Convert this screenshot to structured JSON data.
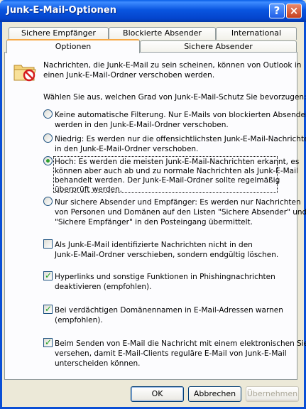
{
  "window": {
    "title": "Junk-E-Mail-Optionen"
  },
  "titlebar_buttons": {
    "help": "?",
    "close": "×"
  },
  "tabs_back": [
    {
      "label": "Sichere Empfänger"
    },
    {
      "label": "Blockierte Absender"
    },
    {
      "label": "International"
    }
  ],
  "tabs_front": [
    {
      "label": "Optionen"
    },
    {
      "label": "Sichere Absender"
    }
  ],
  "intro": {
    "lines": [
      "Nachrichten, die Junk-E-Mail zu sein scheinen, können von Outlook in",
      "einen Junk-E-Mail-Ordner verschoben werden."
    ],
    "icon": "junk-folder-icon"
  },
  "prompt": "Wählen Sie aus, welchen Grad von Junk-E-Mail-Schutz Sie bevorzugen:",
  "radios": [
    {
      "lines": [
        "Keine automatische Filterung. Nur E-Mails von blockierten Absendern",
        "werden in den Junk-E-Mail-Ordner verschoben."
      ],
      "selected": false
    },
    {
      "lines": [
        "Niedrig: Es werden nur die offensichtlichsten Junk-E-Mail-Nachrichten",
        "in den Junk-E-Mail-Ordner verschoben."
      ],
      "selected": false
    },
    {
      "lines": [
        "Hoch: Es werden die meisten Junk-E-Mail-Nachrichten erkannt, es",
        "können aber auch ab und zu normale Nachrichten als Junk-E-Mail",
        "behandelt werden. Der Junk-E-Mail-Ordner sollte regelmäßig",
        "überprüft werden."
      ],
      "selected": true
    },
    {
      "lines": [
        "Nur sichere Absender und Empfänger: Es werden nur Nachrichten",
        "von Personen und Domänen auf den Listen \"Sichere Absender\" und",
        "\"Sichere Empfänger\" in den Posteingang übermittelt."
      ],
      "selected": false
    }
  ],
  "checkboxes": [
    {
      "lines": [
        "Als Junk-E-Mail identifizierte Nachrichten nicht in den",
        "Junk-E-Mail-Ordner verschieben, sondern endgültig löschen."
      ],
      "checked": false
    },
    {
      "lines": [
        "Hyperlinks und sonstige Funktionen in Phishingnachrichten",
        "deaktivieren (empfohlen)."
      ],
      "checked": true
    },
    {
      "lines": [
        "Bei verdächtigen Domänennamen in E-Mail-Adressen warnen",
        "(empfohlen)."
      ],
      "checked": true
    },
    {
      "lines": [
        "Beim Senden von E-Mail die Nachricht mit einem elektronischen Siegel",
        "versehen, damit E-Mail-Clients reguläre E-Mail von Junk-E-Mail",
        "unterscheiden können."
      ],
      "checked": true
    }
  ],
  "buttons": {
    "ok": "OK",
    "cancel": "Abbrechen",
    "apply": "Übernehmen"
  },
  "colors": {
    "titlebar": "#0a5fe8",
    "accent_tab": "#f7a843",
    "check": "#21a121"
  }
}
